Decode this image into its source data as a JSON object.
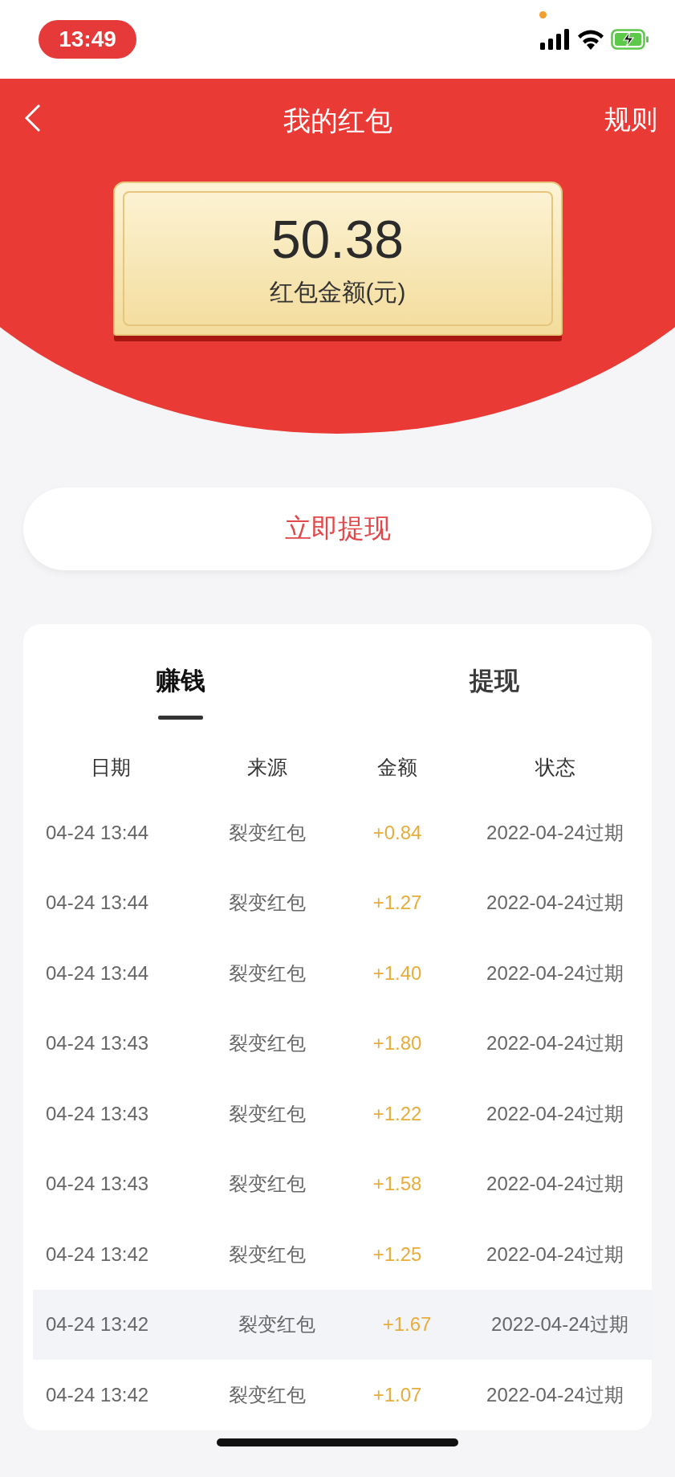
{
  "status_bar": {
    "time": "13:49"
  },
  "header": {
    "title": "我的红包",
    "action": "规则"
  },
  "balance": {
    "amount": "50.38",
    "label": "红包金额(元)"
  },
  "withdraw_button": "立即提现",
  "tabs": [
    {
      "label": "赚钱",
      "selected": true
    },
    {
      "label": "提现",
      "selected": false
    }
  ],
  "table": {
    "columns": [
      "日期",
      "来源",
      "金额",
      "状态"
    ],
    "rows": [
      {
        "date": "04-24 13:44",
        "source": "裂变红包",
        "amount": "+0.84",
        "status": "2022-04-24过期",
        "selected": false
      },
      {
        "date": "04-24 13:44",
        "source": "裂变红包",
        "amount": "+1.27",
        "status": "2022-04-24过期",
        "selected": false
      },
      {
        "date": "04-24 13:44",
        "source": "裂变红包",
        "amount": "+1.40",
        "status": "2022-04-24过期",
        "selected": false
      },
      {
        "date": "04-24 13:43",
        "source": "裂变红包",
        "amount": "+1.80",
        "status": "2022-04-24过期",
        "selected": false
      },
      {
        "date": "04-24 13:43",
        "source": "裂变红包",
        "amount": "+1.22",
        "status": "2022-04-24过期",
        "selected": false
      },
      {
        "date": "04-24 13:43",
        "source": "裂变红包",
        "amount": "+1.58",
        "status": "2022-04-24过期",
        "selected": false
      },
      {
        "date": "04-24 13:42",
        "source": "裂变红包",
        "amount": "+1.25",
        "status": "2022-04-24过期",
        "selected": false
      },
      {
        "date": "04-24 13:42",
        "source": "裂变红包",
        "amount": "+1.67",
        "status": "2022-04-24过期",
        "selected": true
      },
      {
        "date": "04-24 13:42",
        "source": "裂变红包",
        "amount": "+1.07",
        "status": "2022-04-24过期",
        "selected": false
      }
    ]
  }
}
